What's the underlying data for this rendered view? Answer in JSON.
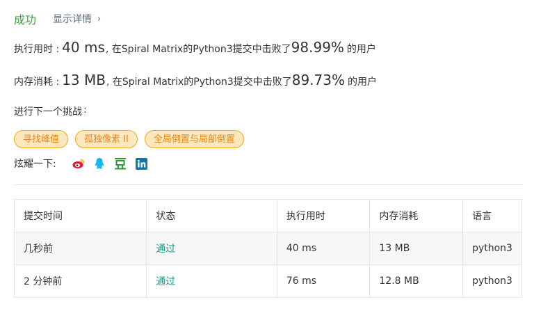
{
  "header": {
    "status": "成功",
    "detail_link": "显示详情"
  },
  "runtime": {
    "label": "执行用时 :",
    "value": "40 ms",
    "middle": ", 在Spiral Matrix的Python3提交中击败了",
    "percent": "98.99%",
    "suffix": "的用户"
  },
  "memory": {
    "label": "内存消耗 :",
    "value": "13 MB",
    "middle": ", 在Spiral Matrix的Python3提交中击败了",
    "percent": "89.73%",
    "suffix": "的用户"
  },
  "next_challenge": {
    "label": "进行下一个挑战",
    "colon": ":",
    "tags": [
      "寻找峰值",
      "孤独像素 II",
      "全局倒置与局部倒置"
    ]
  },
  "share": {
    "label": "炫耀一下:",
    "icons": [
      "weibo-icon",
      "qq-icon",
      "douban-icon",
      "linkedin-icon"
    ]
  },
  "table": {
    "headers": [
      "提交时间",
      "状态",
      "执行用时",
      "内存消耗",
      "语言"
    ],
    "rows": [
      [
        "几秒前",
        "通过",
        "40 ms",
        "13 MB",
        "python3"
      ],
      [
        "2 分钟前",
        "通过",
        "76 ms",
        "12.8 MB",
        "python3"
      ]
    ]
  },
  "colors": {
    "success": "#43a047",
    "tag_border": "#f5a623",
    "tag_bg": "#fde7bd",
    "tag_text": "#e6881c",
    "status_link": "#0f9d8a",
    "weibo": "#e6162d",
    "qq": "#12b7f5",
    "douban": "#2e963d",
    "linkedin": "#0e76a8"
  }
}
